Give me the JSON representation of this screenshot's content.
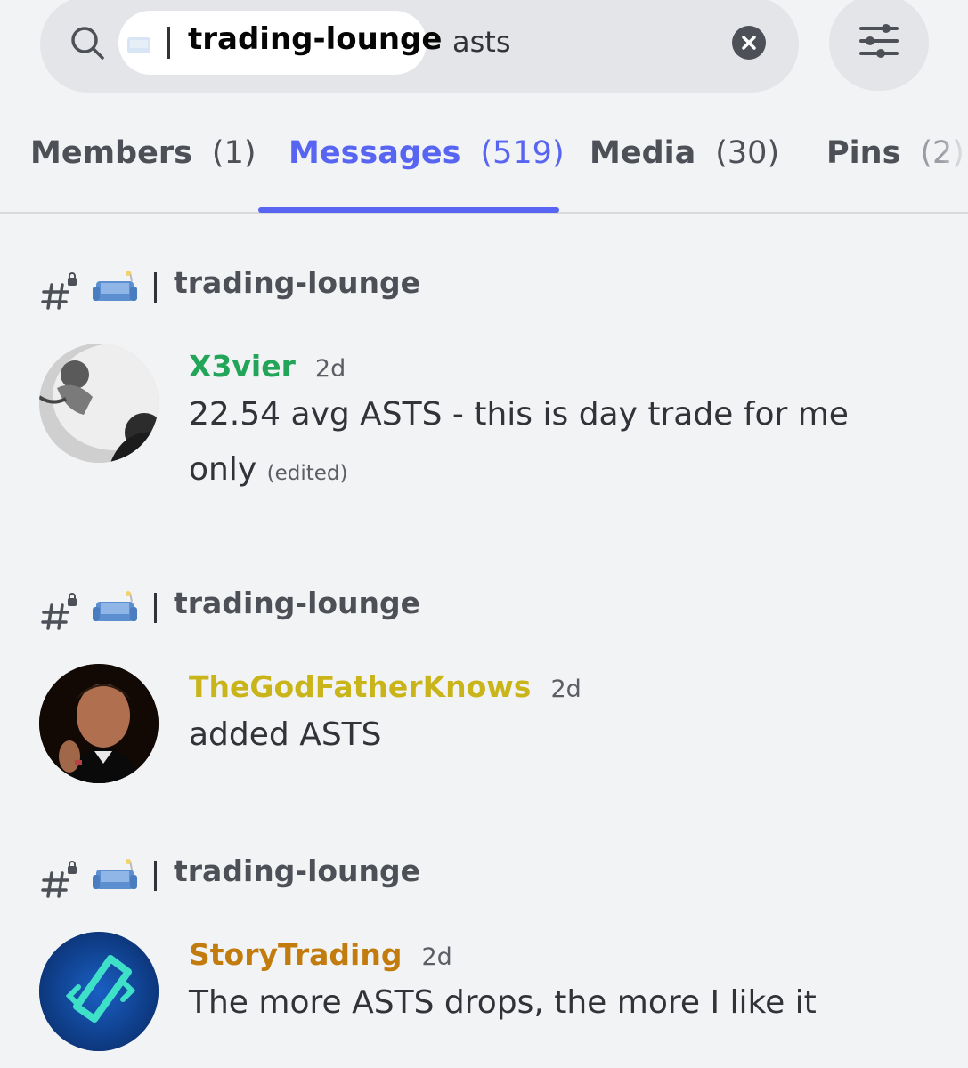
{
  "search": {
    "channel_chip": "trading-lounge",
    "query": "asts"
  },
  "tabs": [
    {
      "label": "Members",
      "count": "(1)",
      "active": false
    },
    {
      "label": "Messages",
      "count": "(519)",
      "active": true
    },
    {
      "label": "Media",
      "count": "(30)",
      "active": false
    },
    {
      "label": "Pins",
      "count": "(2)",
      "active": false
    }
  ],
  "results": [
    {
      "channel": "trading-lounge",
      "author": "X3vier",
      "author_color": "#23a559",
      "time": "2d",
      "text": "22.54 avg ASTS - this is day trade for me only",
      "edited": "(edited)"
    },
    {
      "channel": "trading-lounge",
      "author": "TheGodFatherKnows",
      "author_color": "#c9b51a",
      "time": "2d",
      "text": "added ASTS"
    },
    {
      "channel": "trading-lounge",
      "author": "StoryTrading",
      "author_color": "#c27c0e",
      "time": "2d",
      "text": "The more ASTS drops, the more I like it"
    }
  ],
  "colors": {
    "accent": "#5865f2",
    "background": "#f2f3f5"
  }
}
